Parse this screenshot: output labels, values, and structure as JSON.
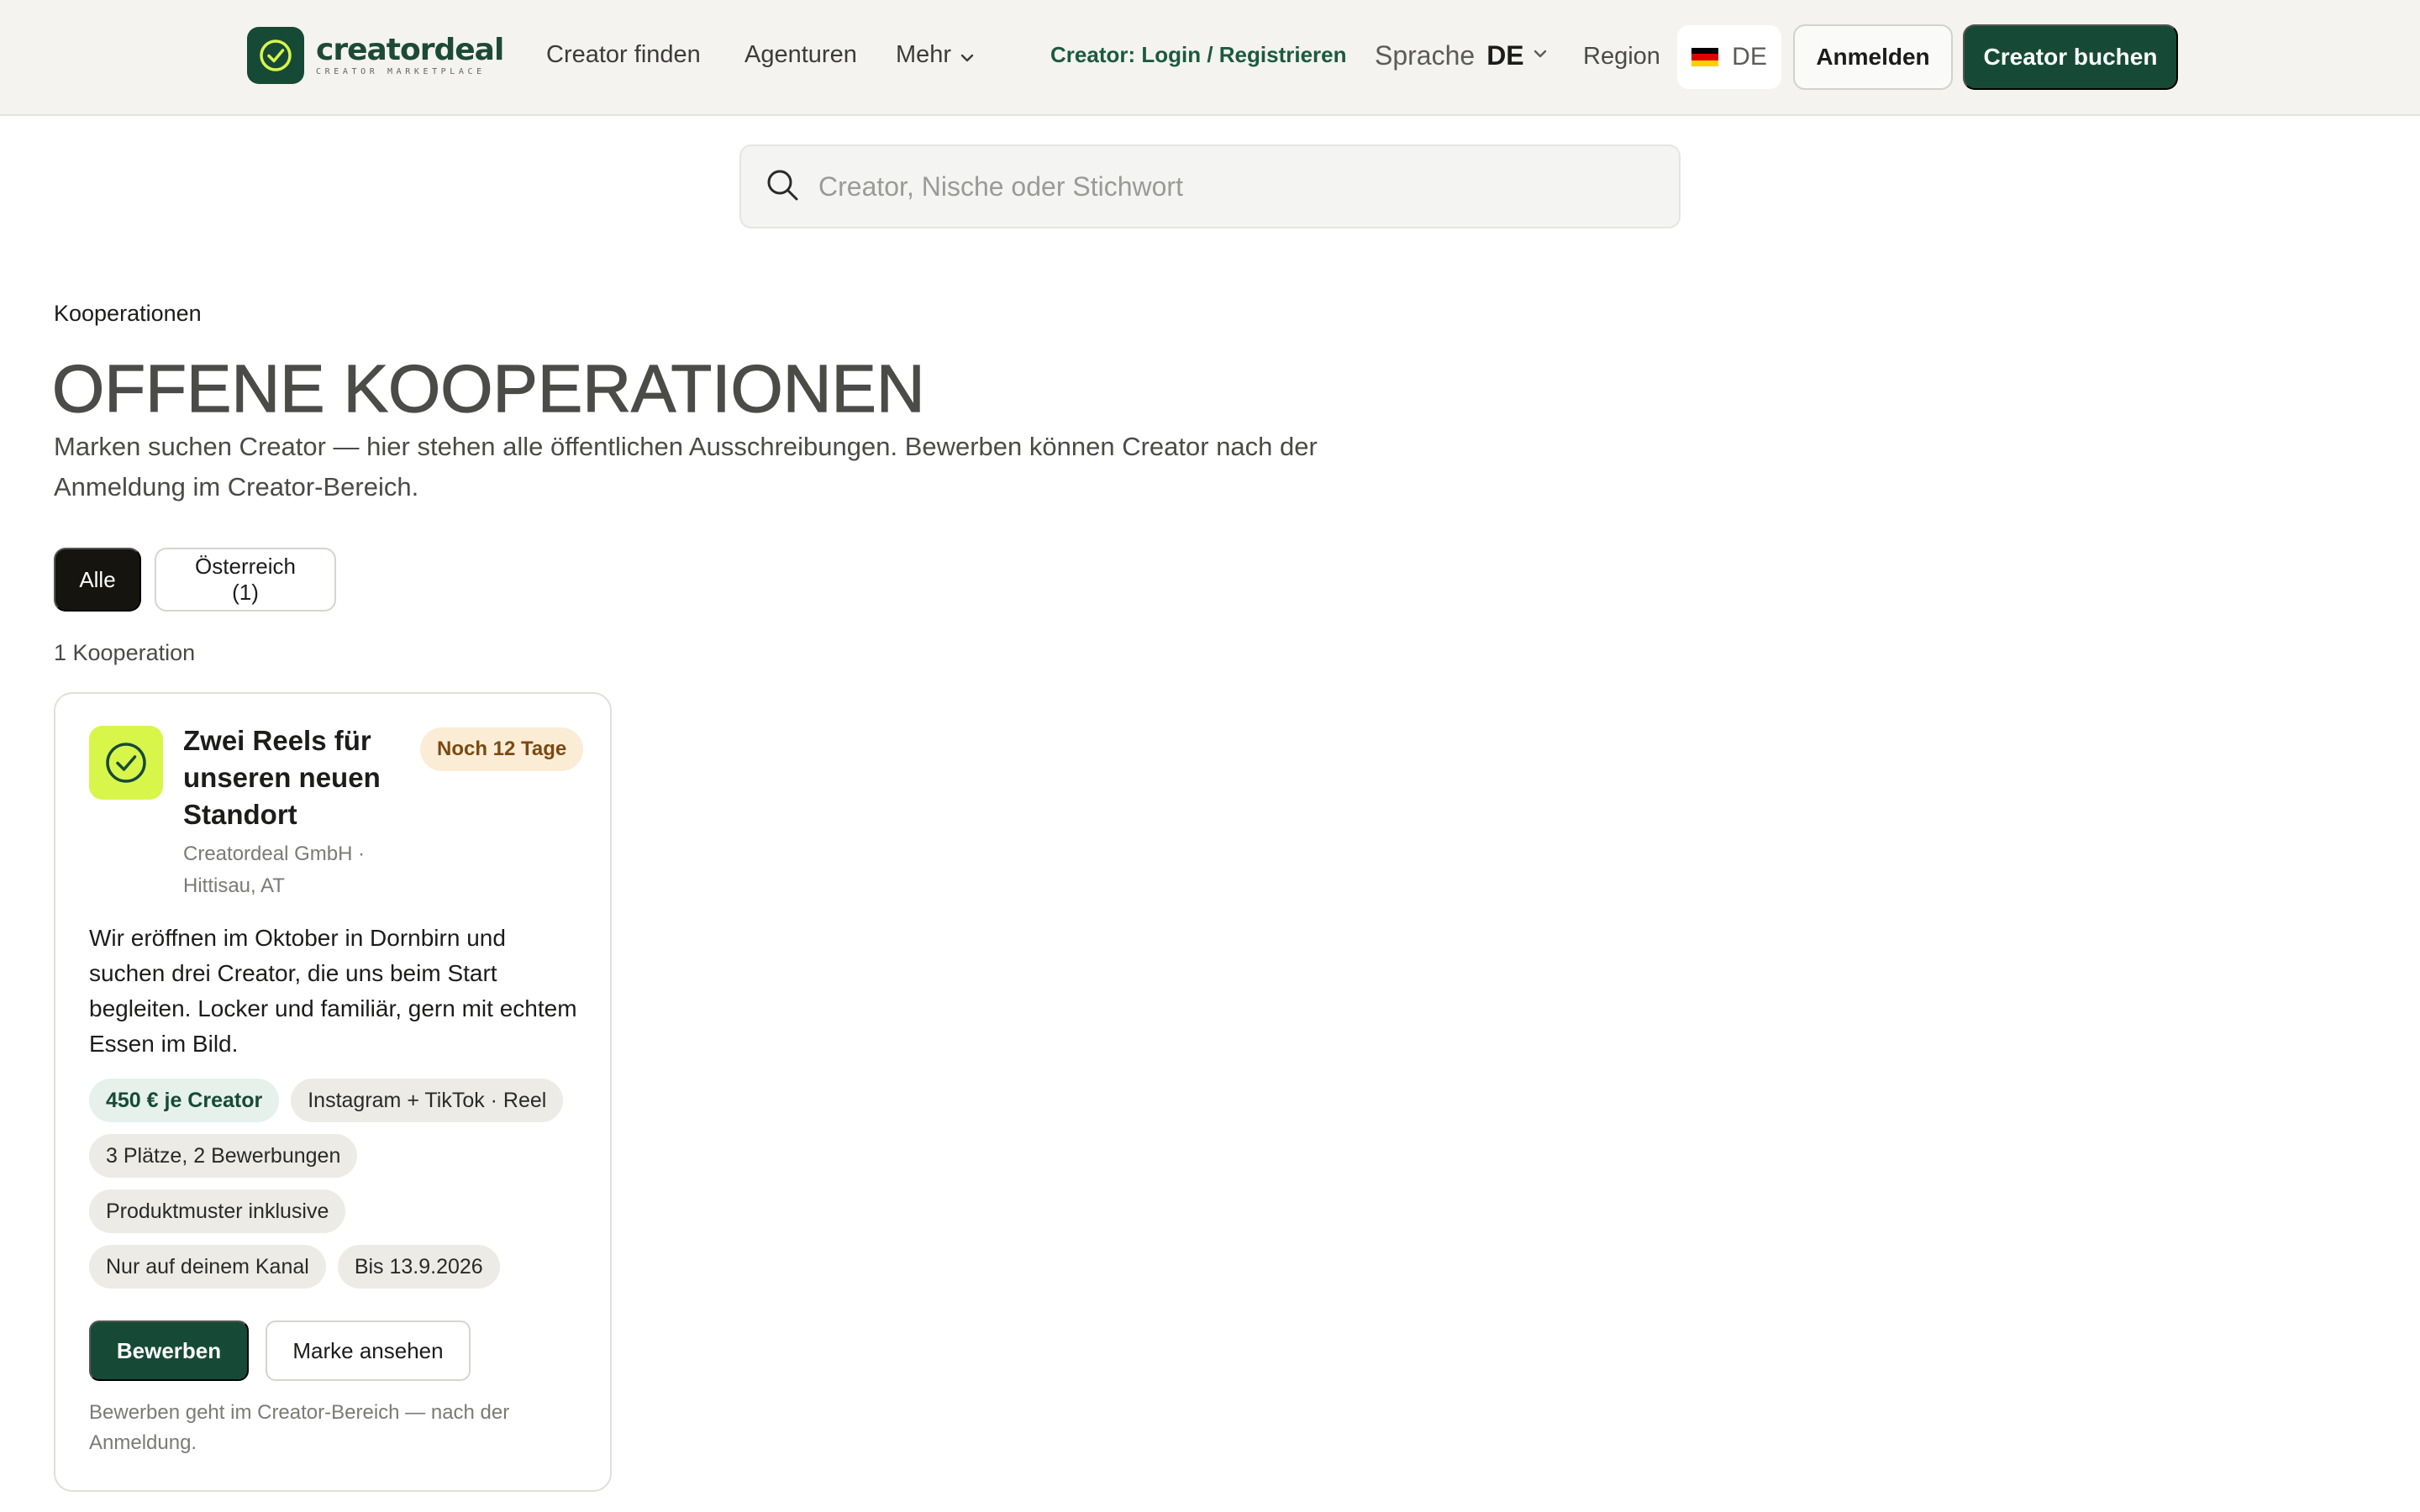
{
  "header": {
    "logo": {
      "wordmark": "creatordeal",
      "tagline": "CREATOR MARKETPLACE"
    },
    "nav": {
      "find_creator": "Creator finden",
      "agencies": "Agenturen",
      "more": "Mehr"
    },
    "creator_login": "Creator: Login / Registrieren",
    "language": {
      "label": "Sprache",
      "value": "DE"
    },
    "region": {
      "label": "Region",
      "value": "DE"
    },
    "signin_label": "Anmelden",
    "book_label": "Creator buchen"
  },
  "search": {
    "placeholder": "Creator, Nische oder Stichwort",
    "value": ""
  },
  "page": {
    "breadcrumb": "Kooperationen",
    "title": "OFFENE KOOPERATIONEN",
    "description": "Marken suchen Creator — hier stehen alle öffentlichen Ausschreibungen. Bewerben können Creator nach der Anmeldung im Creator-Bereich.",
    "filters": [
      {
        "label": "Alle",
        "active": true
      },
      {
        "label": "Österreich (1)",
        "active": false
      }
    ],
    "count_label": "1 Kooperation"
  },
  "cooperations": [
    {
      "title": "Zwei Reels für unseren neuen Standort",
      "deadline_badge": "Noch 12 Tage",
      "company": "Creatordeal GmbH ·",
      "location": "Hittisau, AT",
      "description": "Wir eröffnen im Oktober in Dornbirn und suchen drei Creator, die uns beim Start begleiten. Locker und familiär, gern mit echtem Essen im Bild.",
      "tags": {
        "price": "450 € je Creator",
        "format": "Instagram + TikTok · Reel",
        "slots": "3 Plätze, 2 Bewerbungen",
        "samples": "Produktmuster inklusive",
        "channel": "Nur auf deinem Kanal",
        "until": "Bis 13.9.2026"
      },
      "apply_label": "Bewerben",
      "brand_label": "Marke ansehen",
      "note": "Bewerben geht im Creator-Bereich — nach der Anmeldung."
    }
  ],
  "colors": {
    "brand_green": "#164a36",
    "accent_lime": "#d8f64a",
    "badge_bg": "#fbecd6",
    "header_bg": "#f4f3ef"
  }
}
